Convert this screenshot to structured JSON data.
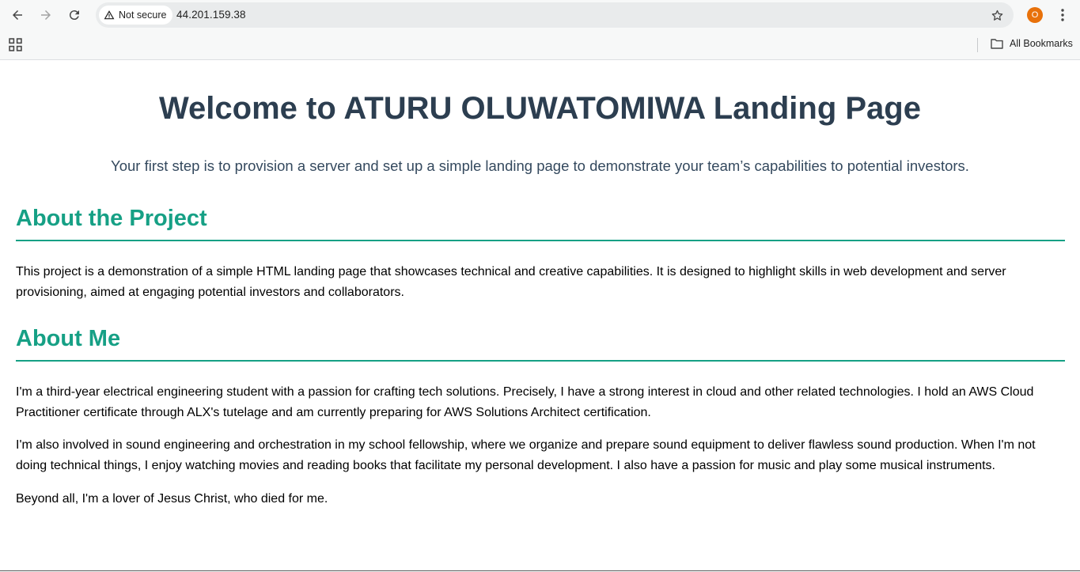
{
  "browser": {
    "security_label": "Not secure",
    "url": "44.201.159.38",
    "profile_initial": "O",
    "all_bookmarks_label": "All Bookmarks",
    "profile_color": "#e8710a"
  },
  "page": {
    "title": "Welcome to ATURU OLUWATOMIWA Landing Page",
    "subtitle": "Your first step is to provision a server and set up a simple landing page to demonstrate your team’s capabilities to potential investors.",
    "sections": [
      {
        "heading": "About the Project",
        "paragraphs": [
          "This project is a demonstration of a simple HTML landing page that showcases technical and creative capabilities. It is designed to highlight skills in web development and server provisioning, aimed at engaging potential investors and collaborators."
        ]
      },
      {
        "heading": "About Me",
        "paragraphs": [
          "I'm a third-year electrical engineering student with a passion for crafting tech solutions. Precisely, I have a strong interest in cloud and other related technologies. I hold an AWS Cloud Practitioner certificate through ALX's tutelage and am currently preparing for AWS Solutions Architect certification.",
          "I'm also involved in sound engineering and orchestration in my school fellowship, where we organize and prepare sound equipment to deliver flawless sound production. When I'm not doing technical things, I enjoy watching movies and reading books that facilitate my personal development. I also have a passion for music and play some musical instruments.",
          "Beyond all, I'm a lover of Jesus Christ, who died for me."
        ]
      }
    ],
    "colors": {
      "title": "#2c3e50",
      "subtitle": "#34495e",
      "accent": "#16a085"
    }
  }
}
